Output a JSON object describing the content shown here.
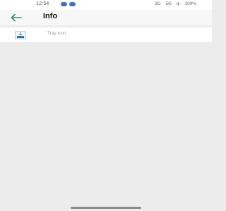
{
  "status_bar": {
    "time": "12:54",
    "right_items": [
      "3G",
      "5G",
      "ψ",
      "100%"
    ]
  },
  "app_bar": {
    "back_icon": "arrow-left-icon",
    "title": "Info"
  },
  "list": {
    "items": [
      {
        "icon": "tray-icon",
        "label": "Tray icon"
      }
    ]
  },
  "colors": {
    "accent": "#2e8b7a",
    "background": "#ececec"
  }
}
